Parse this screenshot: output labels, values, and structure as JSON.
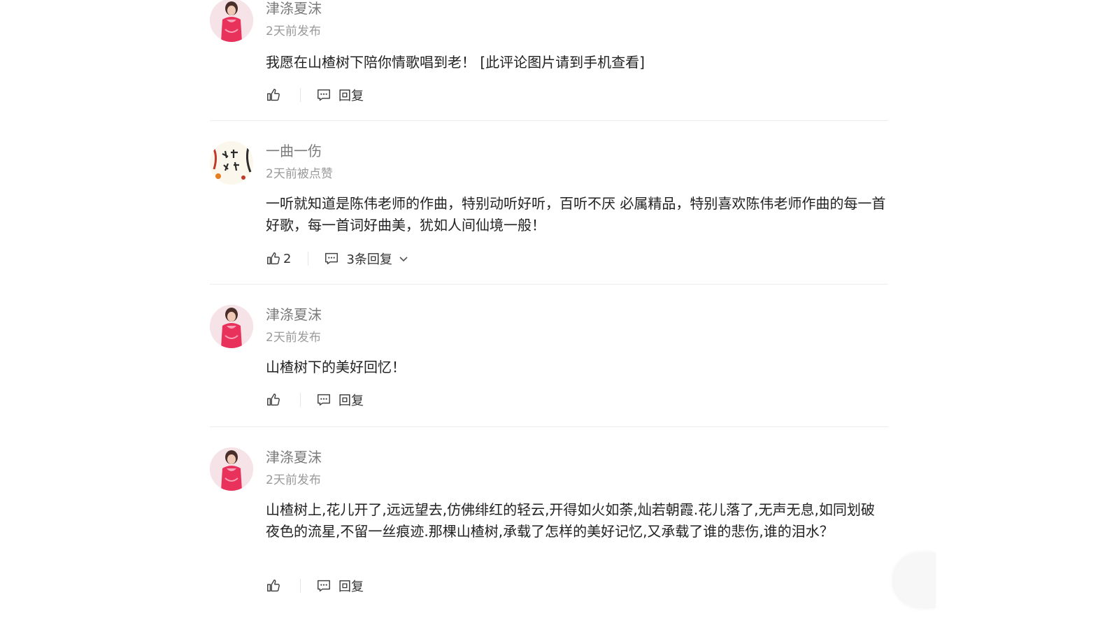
{
  "comments": [
    {
      "user": "津涤夏沫",
      "time": "2天前发布",
      "text": "我愿在山楂树下陪你情歌唱到老！ [此评论图片请到手机查看]",
      "likes": "",
      "reply_label": "回复",
      "avatar_icon": "woman-pink-dress-avatar"
    },
    {
      "user": "一曲一伤",
      "time": "2天前被点赞",
      "text": "一听就知道是陈伟老师的作曲，特别动听好听，百听不厌 必属精品，特别喜欢陈伟老师作曲的每一首好歌，每一首词好曲美，犹如人间仙境一般！",
      "likes": "2",
      "reply_label": "3条回复",
      "avatar_icon": "calligraphy-avatar"
    },
    {
      "user": "津涤夏沫",
      "time": "2天前发布",
      "text": "山楂树下的美好回忆！",
      "likes": "",
      "reply_label": "回复",
      "avatar_icon": "woman-pink-dress-avatar"
    },
    {
      "user": "津涤夏沫",
      "time": "2天前发布",
      "text": "山楂树上,花儿开了,远远望去,仿佛绯红的轻云,开得如火如荼,灿若朝霞.花儿落了,无声无息,如同划破夜色的流星,不留一丝痕迹.那棵山楂树,承载了怎样的美好记忆,又承载了谁的悲伤,谁的泪水？",
      "likes": "",
      "reply_label": "回复",
      "avatar_icon": "woman-pink-dress-avatar"
    }
  ],
  "icons": {
    "like": "thumbs-up-icon",
    "reply": "comment-bubble-icon",
    "expand": "chevron-down-icon"
  },
  "colors": {
    "username": "#7a7a7a",
    "timestamp": "#9a9a9a",
    "text": "#222222",
    "divider": "#ececec",
    "avatar_accent": "#e8315b"
  }
}
